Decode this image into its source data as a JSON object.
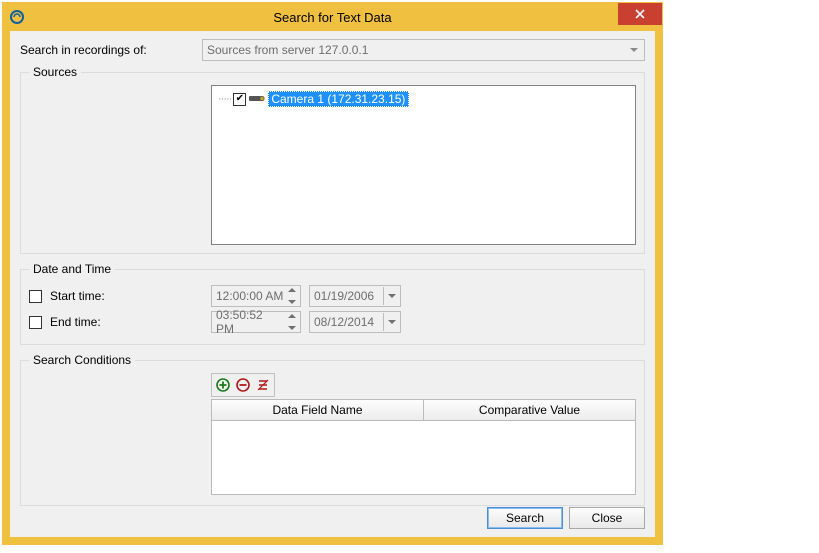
{
  "window": {
    "title": "Search for Text Data"
  },
  "form": {
    "search_in_label": "Search in recordings of:",
    "search_in_value": "Sources from server 127.0.0.1"
  },
  "sources": {
    "legend": "Sources",
    "items": [
      {
        "checked": true,
        "label": "Camera 1 (172.31.23.15)",
        "selected": true,
        "icon": "camera"
      }
    ]
  },
  "datetime": {
    "legend": "Date and Time",
    "start_label": "Start time:",
    "start_checked": false,
    "start_time": "12:00:00 AM",
    "start_date": "01/19/2006",
    "end_label": "End time:",
    "end_checked": false,
    "end_time": "03:50:52 PM",
    "end_date": "08/12/2014"
  },
  "conditions": {
    "legend": "Search Conditions",
    "col_field": "Data Field Name",
    "col_value": "Comparative Value",
    "rows": []
  },
  "footer": {
    "search": "Search",
    "close": "Close"
  }
}
